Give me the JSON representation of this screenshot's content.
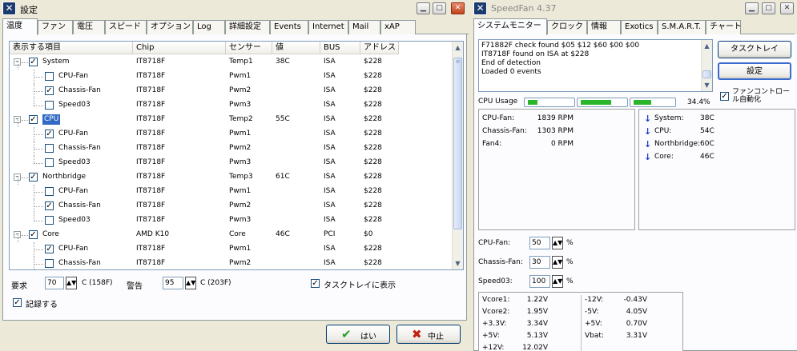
{
  "settings": {
    "title": "設定",
    "tabs": [
      "温度",
      "ファン",
      "電圧",
      "スピード",
      "オプション",
      "Log",
      "詳細設定",
      "Events",
      "Internet",
      "Mail",
      "xAP"
    ],
    "columns": [
      "表示する項目",
      "Chip",
      "センサー",
      "値",
      "BUS",
      "アドレス"
    ],
    "rows": [
      {
        "label": "System",
        "chip": "IT8718F",
        "sensor": "Temp1",
        "value": "38C",
        "bus": "ISA",
        "addr": "$228",
        "checked": true
      },
      {
        "label": "CPU-Fan",
        "chip": "IT8718F",
        "sensor": "Pwm1",
        "value": "",
        "bus": "ISA",
        "addr": "$228",
        "checked": false
      },
      {
        "label": "Chassis-Fan",
        "chip": "IT8718F",
        "sensor": "Pwm2",
        "value": "",
        "bus": "ISA",
        "addr": "$228",
        "checked": true
      },
      {
        "label": "Speed03",
        "chip": "IT8718F",
        "sensor": "Pwm3",
        "value": "",
        "bus": "ISA",
        "addr": "$228",
        "checked": false
      },
      {
        "label": "CPU",
        "chip": "IT8718F",
        "sensor": "Temp2",
        "value": "55C",
        "bus": "ISA",
        "addr": "$228",
        "checked": true
      },
      {
        "label": "CPU-Fan",
        "chip": "IT8718F",
        "sensor": "Pwm1",
        "value": "",
        "bus": "ISA",
        "addr": "$228",
        "checked": true
      },
      {
        "label": "Chassis-Fan",
        "chip": "IT8718F",
        "sensor": "Pwm2",
        "value": "",
        "bus": "ISA",
        "addr": "$228",
        "checked": false
      },
      {
        "label": "Speed03",
        "chip": "IT8718F",
        "sensor": "Pwm3",
        "value": "",
        "bus": "ISA",
        "addr": "$228",
        "checked": false
      },
      {
        "label": "Northbridge",
        "chip": "IT8718F",
        "sensor": "Temp3",
        "value": "61C",
        "bus": "ISA",
        "addr": "$228",
        "checked": true
      },
      {
        "label": "CPU-Fan",
        "chip": "IT8718F",
        "sensor": "Pwm1",
        "value": "",
        "bus": "ISA",
        "addr": "$228",
        "checked": false
      },
      {
        "label": "Chassis-Fan",
        "chip": "IT8718F",
        "sensor": "Pwm2",
        "value": "",
        "bus": "ISA",
        "addr": "$228",
        "checked": true
      },
      {
        "label": "Speed03",
        "chip": "IT8718F",
        "sensor": "Pwm3",
        "value": "",
        "bus": "ISA",
        "addr": "$228",
        "checked": false
      },
      {
        "label": "Core",
        "chip": "AMD K10",
        "sensor": "Core",
        "value": "46C",
        "bus": "PCI",
        "addr": "$0",
        "checked": true
      },
      {
        "label": "CPU-Fan",
        "chip": "IT8718F",
        "sensor": "Pwm1",
        "value": "",
        "bus": "ISA",
        "addr": "$228",
        "checked": true
      },
      {
        "label": "Chassis-Fan",
        "chip": "IT8718F",
        "sensor": "Pwm2",
        "value": "",
        "bus": "ISA",
        "addr": "$228",
        "checked": false
      }
    ],
    "desired_label": "要求",
    "desired_value": "70",
    "desired_unit": "C (158F)",
    "warning_label": "警告",
    "warning_value": "95",
    "warning_unit": "C (203F)",
    "tray_label": "タスクトレイに表示",
    "log_label": "記録する",
    "ok_label": "はい",
    "cancel_label": "中止"
  },
  "speedfan": {
    "title": "SpeedFan 4.37",
    "tabs": [
      "システムモニター",
      "クロック",
      "情報",
      "Exotics",
      "S.M.A.R.T.",
      "チャート"
    ],
    "log_lines": [
      "F71882F check found $05 $12 $60 $00 $00",
      "IT8718F found on ISA at $228",
      "End of detection",
      "Loaded 0 events"
    ],
    "tray_button": "タスクトレイ",
    "settings_button": "設定",
    "auto_fan_label": "ファンコントロール自動化",
    "cpu_usage_label": "CPU Usage",
    "cpu_usage_value": "34.4%",
    "fans": [
      {
        "name": "CPU-Fan:",
        "value": "1839 RPM"
      },
      {
        "name": "Chassis-Fan:",
        "value": "1303 RPM"
      },
      {
        "name": "Fan4:",
        "value": "0 RPM"
      }
    ],
    "temps": [
      {
        "name": "System:",
        "value": "38C"
      },
      {
        "name": "CPU:",
        "value": "54C"
      },
      {
        "name": "Northbridge:",
        "value": "60C"
      },
      {
        "name": "Core:",
        "value": "46C"
      }
    ],
    "speeds": [
      {
        "name": "CPU-Fan:",
        "value": "50",
        "unit": "%"
      },
      {
        "name": "Chassis-Fan:",
        "value": "30",
        "unit": "%"
      },
      {
        "name": "Speed03:",
        "value": "100",
        "unit": "%"
      }
    ],
    "voltages_left": [
      {
        "name": "Vcore1:",
        "value": "1.22V"
      },
      {
        "name": "Vcore2:",
        "value": "1.95V"
      },
      {
        "name": "+3.3V:",
        "value": "3.34V"
      },
      {
        "name": "+5V:",
        "value": "5.13V"
      },
      {
        "name": "+12V:",
        "value": "12.02V"
      }
    ],
    "voltages_right": [
      {
        "name": "-12V:",
        "value": "-0.43V"
      },
      {
        "name": "-5V:",
        "value": "4.05V"
      },
      {
        "name": "+5V:",
        "value": "0.70V"
      },
      {
        "name": "Vbat:",
        "value": "3.31V"
      }
    ]
  }
}
